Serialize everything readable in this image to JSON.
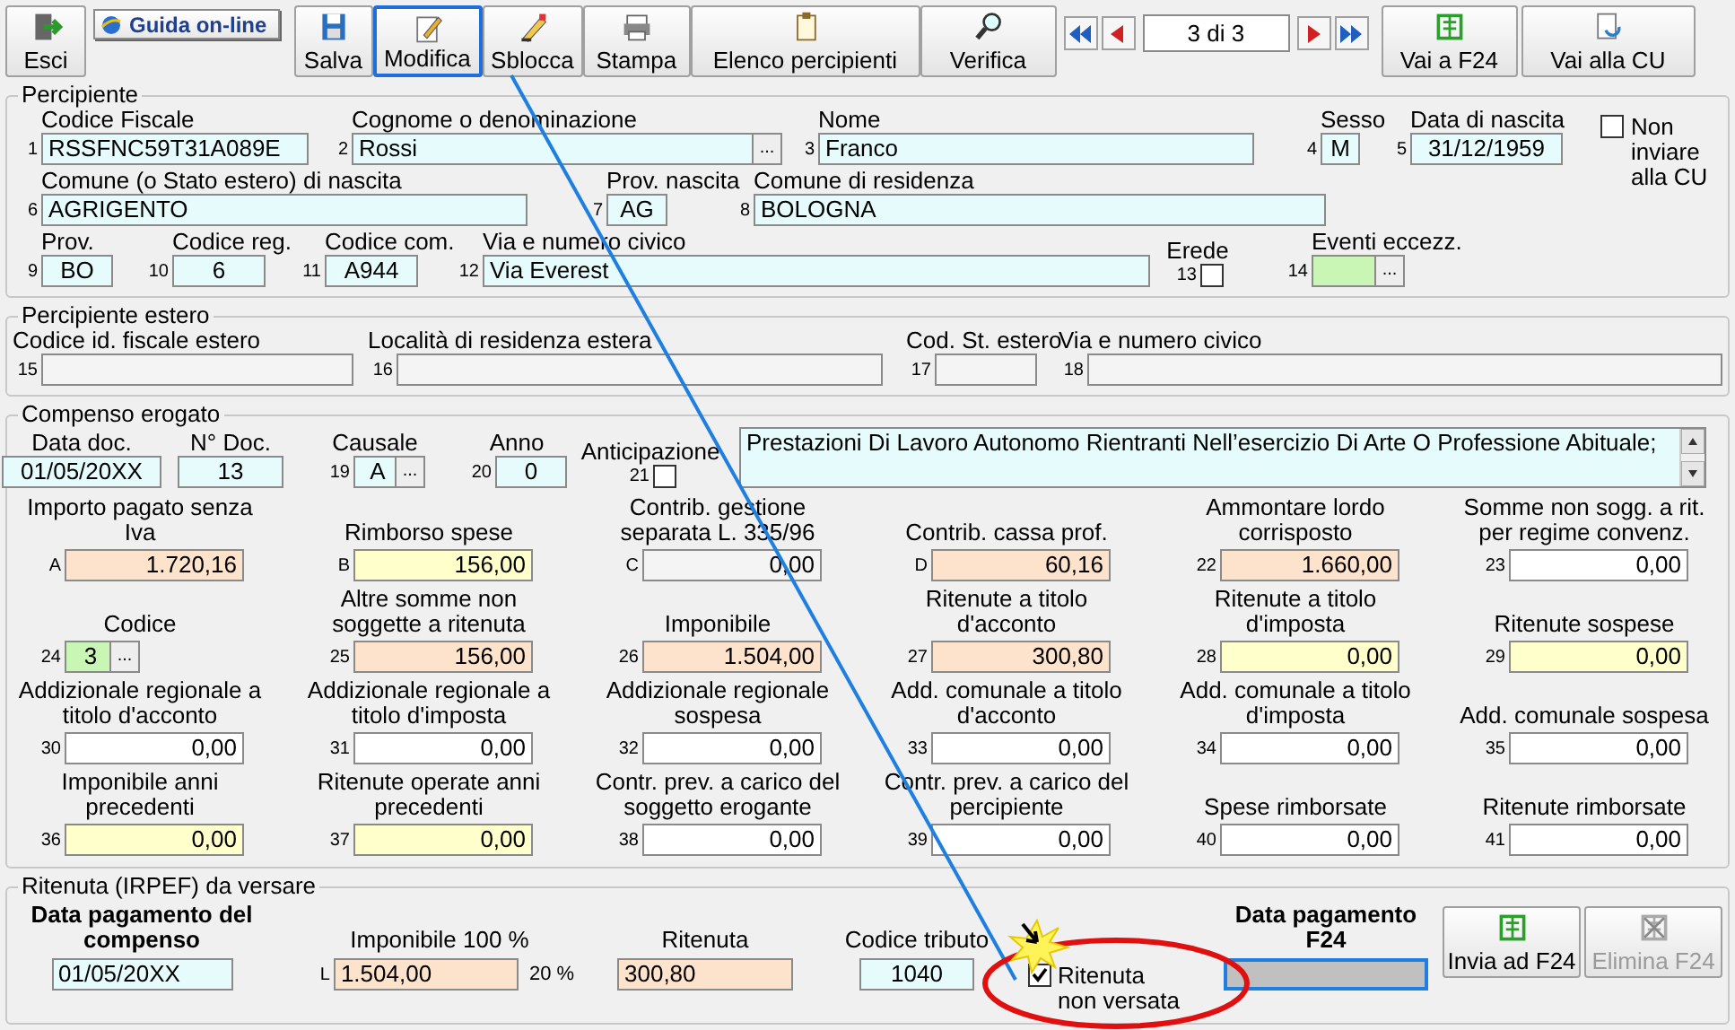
{
  "toolbar": {
    "exit": {
      "label": "Esci"
    },
    "help": {
      "label": "Guida on-line"
    },
    "buttons": [
      {
        "label": "Salva",
        "selected": false
      },
      {
        "label": "Modifica",
        "selected": true
      },
      {
        "label": "Sblocca",
        "selected": false
      },
      {
        "label": "Stampa",
        "selected": false
      },
      {
        "label": "Elenco percipienti",
        "selected": false
      },
      {
        "label": "Verifica",
        "selected": false
      }
    ],
    "record": "3 di 3",
    "links": [
      {
        "label": "Vai a F24"
      },
      {
        "label": "Vai alla CU"
      }
    ]
  },
  "sections": [
    {
      "title": "Percipiente",
      "lines": [
        {
          "fields": [
            {
              "num": "1",
              "label": "Codice Fiscale",
              "value": "RSSFNC59T31A089E",
              "color": "#e6fcfc",
              "kind": "text"
            },
            {
              "num": "2",
              "label": "Cognome o denominazione",
              "value": "Rossi",
              "color": "#e6fcfc",
              "kind": "lookup",
              "button": "..."
            },
            {
              "num": "3",
              "label": "Nome",
              "value": "Franco",
              "color": "#e6fcfc",
              "kind": "text"
            },
            {
              "num": "4",
              "label": "Sesso",
              "value": "M",
              "color": "#e6fcfc",
              "kind": "text"
            },
            {
              "num": "5",
              "label": "Data di nascita",
              "value": "31/12/1959",
              "color": "#e6fcfc",
              "kind": "text"
            },
            {
              "label": "Non inviare alla CU",
              "kind": "sidecheck",
              "checked": false
            }
          ]
        },
        {
          "fields": [
            {
              "num": "6",
              "label": "Comune (o Stato estero) di nascita",
              "value": "AGRIGENTO",
              "color": "#e6fcfc",
              "kind": "text"
            },
            {
              "num": "7",
              "label": "Prov. nascita",
              "value": "AG",
              "color": "#e6fcfc",
              "kind": "text"
            },
            {
              "num": "8",
              "label": "Comune di residenza",
              "value": "BOLOGNA",
              "color": "#e6fcfc",
              "kind": "text"
            }
          ]
        },
        {
          "fields": [
            {
              "num": "9",
              "label": "Prov.",
              "value": "BO",
              "color": "#e6fcfc",
              "kind": "text"
            },
            {
              "num": "10",
              "label": "Codice reg.",
              "value": "6",
              "color": "#e6fcfc",
              "kind": "text"
            },
            {
              "num": "11",
              "label": "Codice com.",
              "value": "A944",
              "color": "#e6fcfc",
              "kind": "text"
            },
            {
              "num": "12",
              "label": "Via e numero civico",
              "value": "Via Everest",
              "color": "#e6fcfc",
              "kind": "text"
            },
            {
              "num": "13",
              "label": "Erede",
              "kind": "check",
              "checked": false
            },
            {
              "num": "14",
              "label": "Eventi eccezz.",
              "color": "#c9f5b5",
              "kind": "lookup",
              "button": "..."
            }
          ]
        }
      ]
    },
    {
      "title": "Percipiente estero",
      "lines": [
        {
          "fields": [
            {
              "num": "15",
              "label": "Codice id. fiscale estero",
              "color": "#f4f4f4",
              "kind": "text"
            },
            {
              "num": "16",
              "label": "Località di residenza estera",
              "color": "#f4f4f4",
              "kind": "text"
            },
            {
              "num": "17",
              "label": "Cod. St. estero",
              "color": "#f4f4f4",
              "kind": "text"
            },
            {
              "num": "18",
              "label": "Via e numero civico",
              "color": "#f4f4f4",
              "kind": "text"
            }
          ]
        }
      ]
    },
    {
      "title": "Compenso erogato",
      "lines": [
        {
          "fields": [
            {
              "label": "Data doc.",
              "value": "01/05/20XX",
              "color": "#e6fcfc",
              "kind": "text"
            },
            {
              "label": "N° Doc.",
              "value": "13",
              "color": "#e6fcfc",
              "kind": "text"
            },
            {
              "num": "19",
              "label": "Causale",
              "value": "A",
              "color": "#e6fcfc",
              "kind": "lookup",
              "button": "..."
            },
            {
              "num": "20",
              "label": "Anno",
              "value": "0",
              "color": "#e6fcfc",
              "kind": "text"
            },
            {
              "num": "21",
              "label": "Anticipazione",
              "kind": "check",
              "checked": false
            },
            {
              "value": "Prestazioni Di Lavoro Autonomo Rientranti Nell’esercizio Di Arte O Professione Abituale;",
              "color": "#e6fcfc",
              "kind": "memo"
            }
          ]
        },
        {
          "fields": [
            {
              "num": "A",
              "label": "Importo pagato senza Iva",
              "value": "1.720,16",
              "color": "#fde3cc",
              "kind": "text"
            },
            {
              "num": "B",
              "label": "Rimborso spese",
              "value": "156,00",
              "color": "#ffffcc",
              "kind": "text"
            },
            {
              "num": "C",
              "label": "Contrib. gestione separata L. 335/96",
              "value": "0,00",
              "color": "#f4f4f4",
              "kind": "text"
            },
            {
              "num": "D",
              "label": "Contrib. cassa prof.",
              "value": "60,16",
              "color": "#fde3cc",
              "kind": "text"
            },
            {
              "num": "22",
              "label": "Ammontare lordo corrisposto",
              "value": "1.660,00",
              "color": "#fde3cc",
              "kind": "text"
            },
            {
              "num": "23",
              "label": "Somme non sogg. a rit. per regime convenz.",
              "value": "0,00",
              "color": "#ffffff",
              "kind": "text"
            }
          ]
        },
        {
          "fields": [
            {
              "num": "24",
              "label": "Codice",
              "value": "3",
              "color": "#c9f5b5",
              "kind": "lookup",
              "button": "..."
            },
            {
              "num": "25",
              "label": "Altre somme non soggette a ritenuta",
              "value": "156,00",
              "color": "#fde3cc",
              "kind": "text"
            },
            {
              "num": "26",
              "label": "Imponibile",
              "value": "1.504,00",
              "color": "#fde3cc",
              "kind": "text"
            },
            {
              "num": "27",
              "label": "Ritenute a titolo d'acconto",
              "value": "300,80",
              "color": "#fde3cc",
              "kind": "text"
            },
            {
              "num": "28",
              "label": "Ritenute a titolo d'imposta",
              "value": "0,00",
              "color": "#ffffcc",
              "kind": "text"
            },
            {
              "num": "29",
              "label": "Ritenute sospese",
              "value": "0,00",
              "color": "#ffffcc",
              "kind": "text"
            }
          ]
        },
        {
          "fields": [
            {
              "num": "30",
              "label": "Addizionale regionale a titolo d'acconto",
              "value": "0,00",
              "color": "#ffffff",
              "kind": "text"
            },
            {
              "num": "31",
              "label": "Addizionale regionale a titolo d'imposta",
              "value": "0,00",
              "color": "#ffffff",
              "kind": "text"
            },
            {
              "num": "32",
              "label": "Addizionale regionale sospesa",
              "value": "0,00",
              "color": "#ffffff",
              "kind": "text"
            },
            {
              "num": "33",
              "label": "Add. comunale a titolo d'acconto",
              "value": "0,00",
              "color": "#ffffff",
              "kind": "text"
            },
            {
              "num": "34",
              "label": "Add. comunale a titolo d'imposta",
              "value": "0,00",
              "color": "#ffffff",
              "kind": "text"
            },
            {
              "num": "35",
              "label": "Add. comunale sospesa",
              "value": "0,00",
              "color": "#ffffff",
              "kind": "text"
            }
          ]
        },
        {
          "fields": [
            {
              "num": "36",
              "label": "Imponibile anni precedenti",
              "value": "0,00",
              "color": "#ffffcc",
              "kind": "text"
            },
            {
              "num": "37",
              "label": "Ritenute operate anni precedenti",
              "value": "0,00",
              "color": "#ffffcc",
              "kind": "text"
            },
            {
              "num": "38",
              "label": "Contr. prev. a carico del soggetto erogante",
              "value": "0,00",
              "color": "#ffffff",
              "kind": "text"
            },
            {
              "num": "39",
              "label": "Contr. prev. a carico del percipiente",
              "value": "0,00",
              "color": "#ffffff",
              "kind": "text"
            },
            {
              "num": "40",
              "label": "Spese rimborsate",
              "value": "0,00",
              "color": "#ffffff",
              "kind": "text"
            },
            {
              "num": "41",
              "label": "Ritenute rimborsate",
              "value": "0,00",
              "color": "#ffffff",
              "kind": "text"
            }
          ]
        }
      ]
    },
    {
      "title": "Ritenuta (IRPEF) da versare",
      "lines": [
        {
          "fields": [
            {
              "label": "Data pagamento del compenso",
              "emphasis": true,
              "value": "01/05/20XX",
              "color": "#e6fcfc",
              "kind": "text"
            },
            {
              "num": "L",
              "label": "Imponibile 100 %",
              "value": "1.504,00",
              "suffix": "20 %",
              "color": "#fde3cc",
              "kind": "text"
            },
            {
              "label": "Ritenuta",
              "value": "300,80",
              "color": "#fde3cc",
              "kind": "text"
            },
            {
              "label": "Codice tributo",
              "value": "1040",
              "color": "#e6fcfc",
              "kind": "text"
            },
            {
              "label": "Ritenuta non versata",
              "kind": "sidecheck",
              "checked": true
            },
            {
              "label": "Data pagamento F24",
              "emphasis": true,
              "color": "#c0c0c0",
              "kind": "text",
              "focused": true
            }
          ]
        }
      ],
      "buttons": [
        {
          "label": "Invia ad F24",
          "disabled": false
        },
        {
          "label": "Elimina F24",
          "disabled": true
        }
      ]
    }
  ]
}
